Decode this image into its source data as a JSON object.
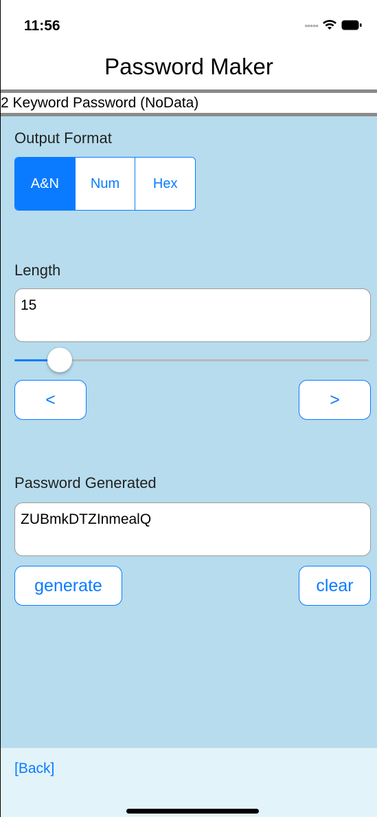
{
  "status_bar": {
    "time": "11:56",
    "signal_icon": "signal-dots-icon",
    "wifi_icon": "wifi-icon",
    "battery_icon": "battery-icon"
  },
  "nav": {
    "title": "Password Maker"
  },
  "subtitle": "2 Keyword Password (NoData)",
  "output_format": {
    "label": "Output Format",
    "options": [
      "A&N",
      "Num",
      "Hex"
    ],
    "selected": "A&N"
  },
  "length": {
    "label": "Length",
    "value": "15",
    "slider_level": 0.09,
    "prev_label": "<",
    "next_label": ">"
  },
  "password": {
    "label": "Password Generated",
    "value": "ZUBmkDTZInmealQ",
    "generate_label": "generate",
    "clear_label": "clear"
  },
  "toolbar": {
    "back_label": "[Back]"
  },
  "colors": {
    "accent": "#0a7bff",
    "background": "#b6dced",
    "toolbar": "#e3f3fa",
    "divider": "#8a8a8a"
  }
}
